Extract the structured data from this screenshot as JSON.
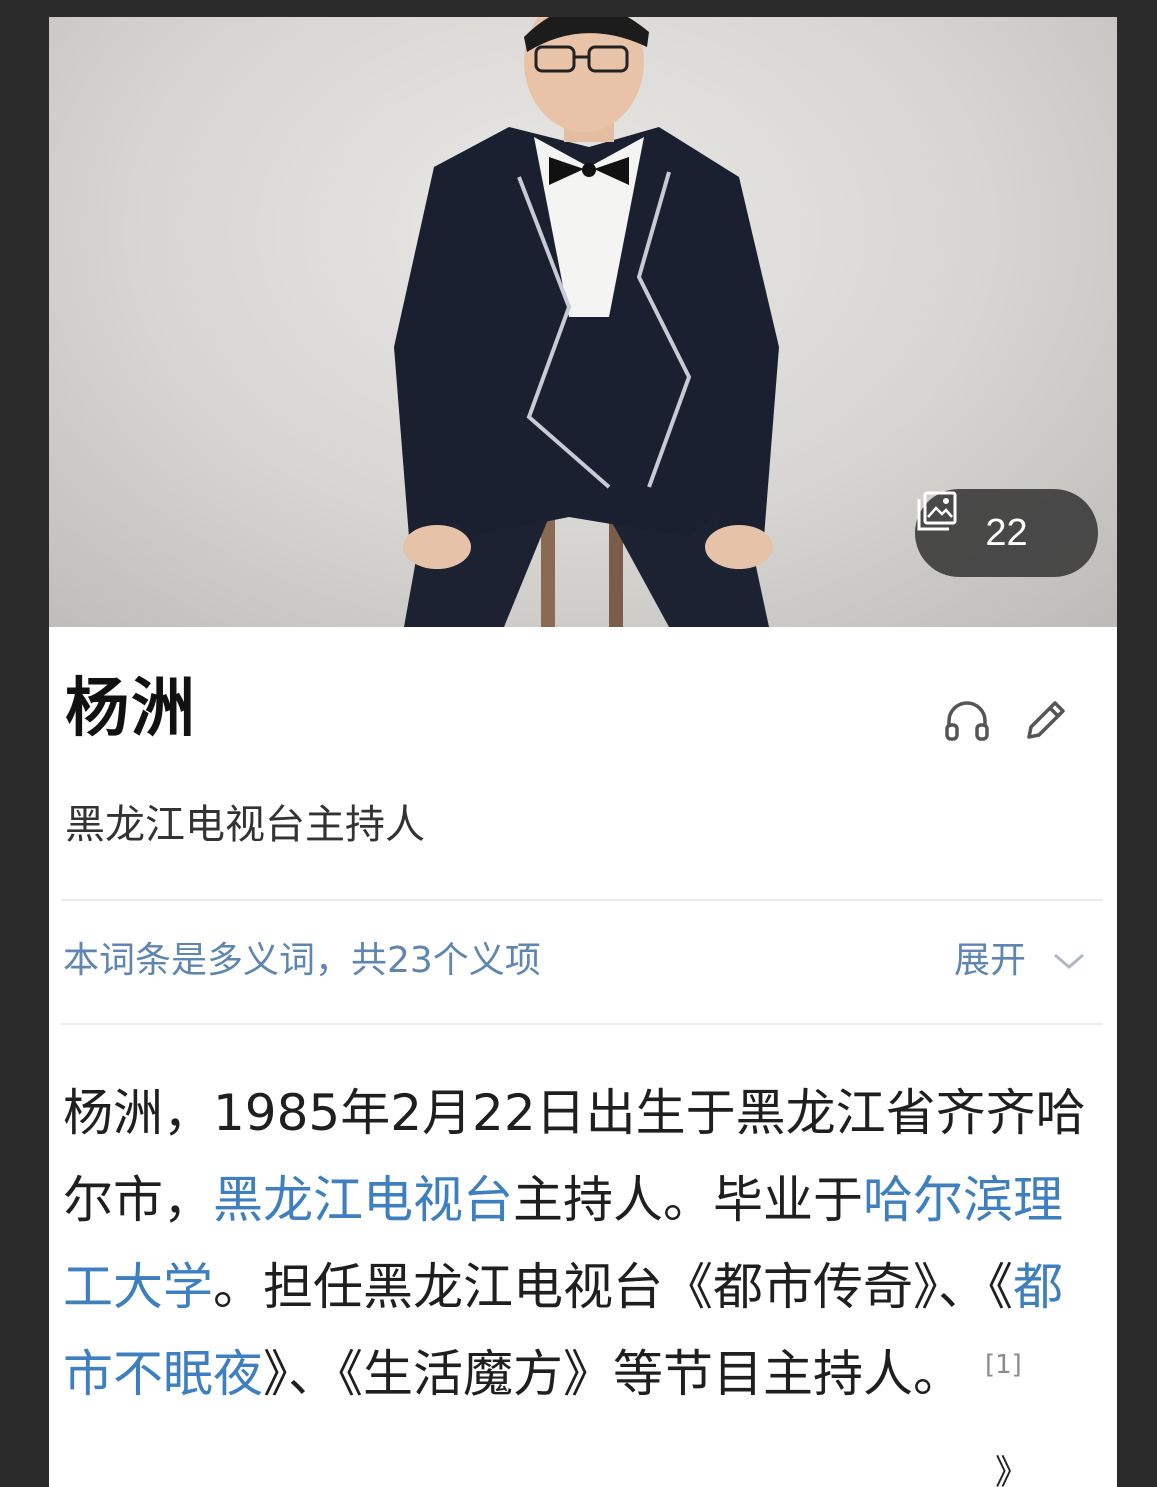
{
  "hero": {
    "photo_icon": "gallery-icon",
    "photo_count": "22"
  },
  "entry": {
    "title": "杨洲",
    "subtitle": "黑龙江电视台主持人",
    "actions": [
      {
        "icon": "headphones-icon"
      },
      {
        "icon": "edit-pencil-icon"
      }
    ]
  },
  "polysemy": {
    "text": "本词条是多义词，共23个义项",
    "expand_label": "展开",
    "expand_icon": "chevron-down-icon"
  },
  "summary": {
    "p1": "杨洲，1985年2月22日出生于黑龙江省齐齐哈尔市，",
    "link1": "黑龙江电视台",
    "p2": "主持人。毕业于",
    "link2": "哈尔滨理工大学",
    "p3": "。担任黑龙江电视台《都市传奇》、《",
    "link3": "都市不眠夜",
    "p4": "》、《生活魔方》等节目主持人。",
    "ref": "[1]",
    "stray": "》"
  },
  "colors": {
    "link": "#3e7fc0",
    "polysemy": "#5f86b0",
    "background": "#2b2b2b"
  }
}
